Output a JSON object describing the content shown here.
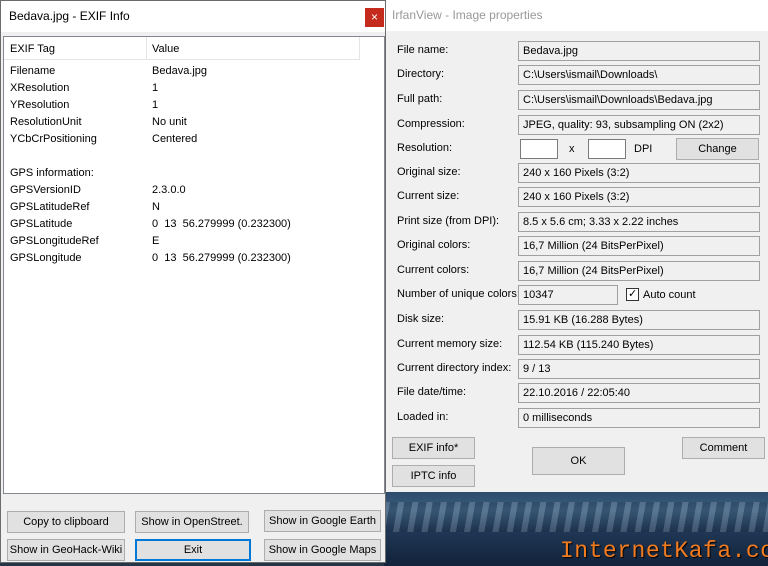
{
  "exif_window": {
    "title": "Bedava.jpg - EXIF Info",
    "close_glyph": "×",
    "columns": [
      "EXIF Tag",
      "Value"
    ],
    "rows": [
      {
        "tag": "Filename",
        "value": "Bedava.jpg"
      },
      {
        "tag": "XResolution",
        "value": "1"
      },
      {
        "tag": "YResolution",
        "value": "1"
      },
      {
        "tag": "ResolutionUnit",
        "value": "No unit"
      },
      {
        "tag": "YCbCrPositioning",
        "value": "Centered"
      },
      {
        "tag": "",
        "value": ""
      },
      {
        "tag": "GPS information:",
        "value": ""
      },
      {
        "tag": "GPSVersionID",
        "value": "2.3.0.0"
      },
      {
        "tag": "GPSLatitudeRef",
        "value": "N"
      },
      {
        "tag": "GPSLatitude",
        "value": "0  13  56.279999 (0.232300)"
      },
      {
        "tag": "GPSLongitudeRef",
        "value": "E"
      },
      {
        "tag": "GPSLongitude",
        "value": "0  13  56.279999 (0.232300)"
      }
    ],
    "buttons": {
      "copy": "Copy to clipboard",
      "openstreet": "Show in OpenStreet.",
      "google_earth": "Show in Google Earth",
      "geohack": "Show in GeoHack-Wiki",
      "exit": "Exit",
      "google_maps": "Show in Google Maps"
    }
  },
  "props_window": {
    "title": "IrfanView - Image properties",
    "fields": [
      {
        "label": "File name:",
        "value": "Bedava.jpg"
      },
      {
        "label": "Directory:",
        "value": "C:\\Users\\ismail\\Downloads\\"
      },
      {
        "label": "Full path:",
        "value": "C:\\Users\\ismail\\Downloads\\Bedava.jpg"
      },
      {
        "label": "Compression:",
        "value": "JPEG, quality: 93, subsampling ON (2x2)"
      }
    ],
    "resolution": {
      "label": "Resolution:",
      "x": "x",
      "unit": "DPI",
      "change_button": "Change"
    },
    "fields2": [
      {
        "label": "Original size:",
        "value": "240 x 160  Pixels (3:2)"
      },
      {
        "label": "Current size:",
        "value": "240 x 160  Pixels (3:2)"
      },
      {
        "label": "Print size (from DPI):",
        "value": "8.5 x 5.6 cm; 3.33 x 2.22 inches"
      },
      {
        "label": "Original colors:",
        "value": "16,7 Million  (24 BitsPerPixel)"
      },
      {
        "label": "Current colors:",
        "value": "16,7 Million  (24 BitsPerPixel)"
      }
    ],
    "unique_colors": {
      "label": "Number of unique colors:",
      "value": "10347",
      "auto_count_label": "Auto count",
      "auto_count_checked": true
    },
    "fields3": [
      {
        "label": "Disk size:",
        "value": "15.91 KB (16.288 Bytes)"
      },
      {
        "label": "Current memory size:",
        "value": "112.54  KB (115.240 Bytes)"
      },
      {
        "label": "Current directory index:",
        "value": "9  /  13"
      },
      {
        "label": "File date/time:",
        "value": "22.10.2016 / 22:05:40"
      },
      {
        "label": "Loaded in:",
        "value": "0 milliseconds"
      }
    ],
    "buttons": {
      "exif": "EXIF info*",
      "iptc": "IPTC info",
      "ok": "OK",
      "comment": "Comment"
    }
  },
  "watermark": "InternetKafa.com"
}
